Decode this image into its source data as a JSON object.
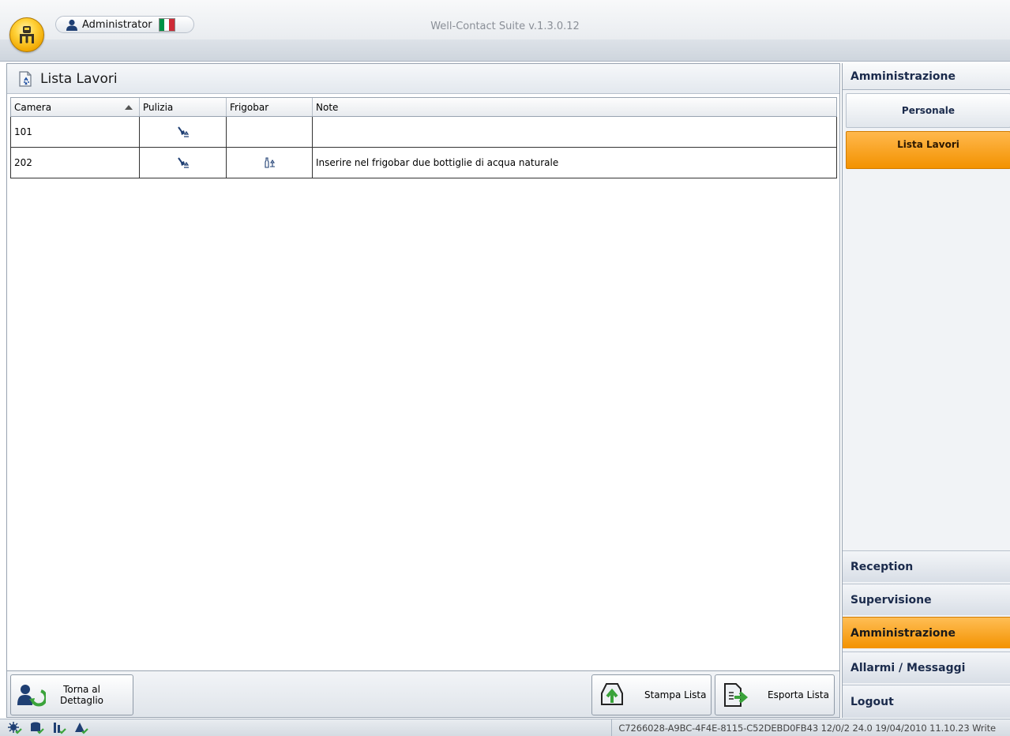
{
  "titlebar": {
    "user": "Administrator",
    "app_title": "Well-Contact Suite v.1.3.0.12",
    "orb_icon": "building-keys-icon",
    "flag_colors": [
      "#009246",
      "#ffffff",
      "#ce2b37"
    ]
  },
  "panel": {
    "title": "Lista Lavori",
    "columns": [
      "Camera",
      "Pulizia",
      "Frigobar",
      "Note"
    ],
    "sort_column": "Camera",
    "rows": [
      {
        "camera": "101",
        "pulizia": "cleaning-icon",
        "frigobar": "",
        "note": ""
      },
      {
        "camera": "202",
        "pulizia": "cleaning-icon",
        "frigobar": "minibar-icon",
        "note": "Inserire nel frigobar due bottiglie di acqua naturale"
      }
    ]
  },
  "buttons": {
    "back_label_1": "Torna al",
    "back_label_2": "Dettaglio",
    "print_label": "Stampa Lista",
    "export_label": "Esporta Lista"
  },
  "nav": {
    "header": "Amministrazione",
    "sub_items": [
      "Personale",
      "Lista Lavori"
    ],
    "active_sub": "Lista Lavori",
    "sections": [
      "Reception",
      "Supervisione",
      "Amministrazione",
      "Allarmi / Messaggi",
      "Logout"
    ],
    "active_section": "Amministrazione"
  },
  "status": {
    "info": "C7266028-A9BC-4F4E-8115-C52DEBD0FB43 12/0/2 24.0 19/04/2010 11.10.23 Write"
  },
  "colors": {
    "accent_orange": "#f39200",
    "nav_text": "#1b2b4c"
  }
}
